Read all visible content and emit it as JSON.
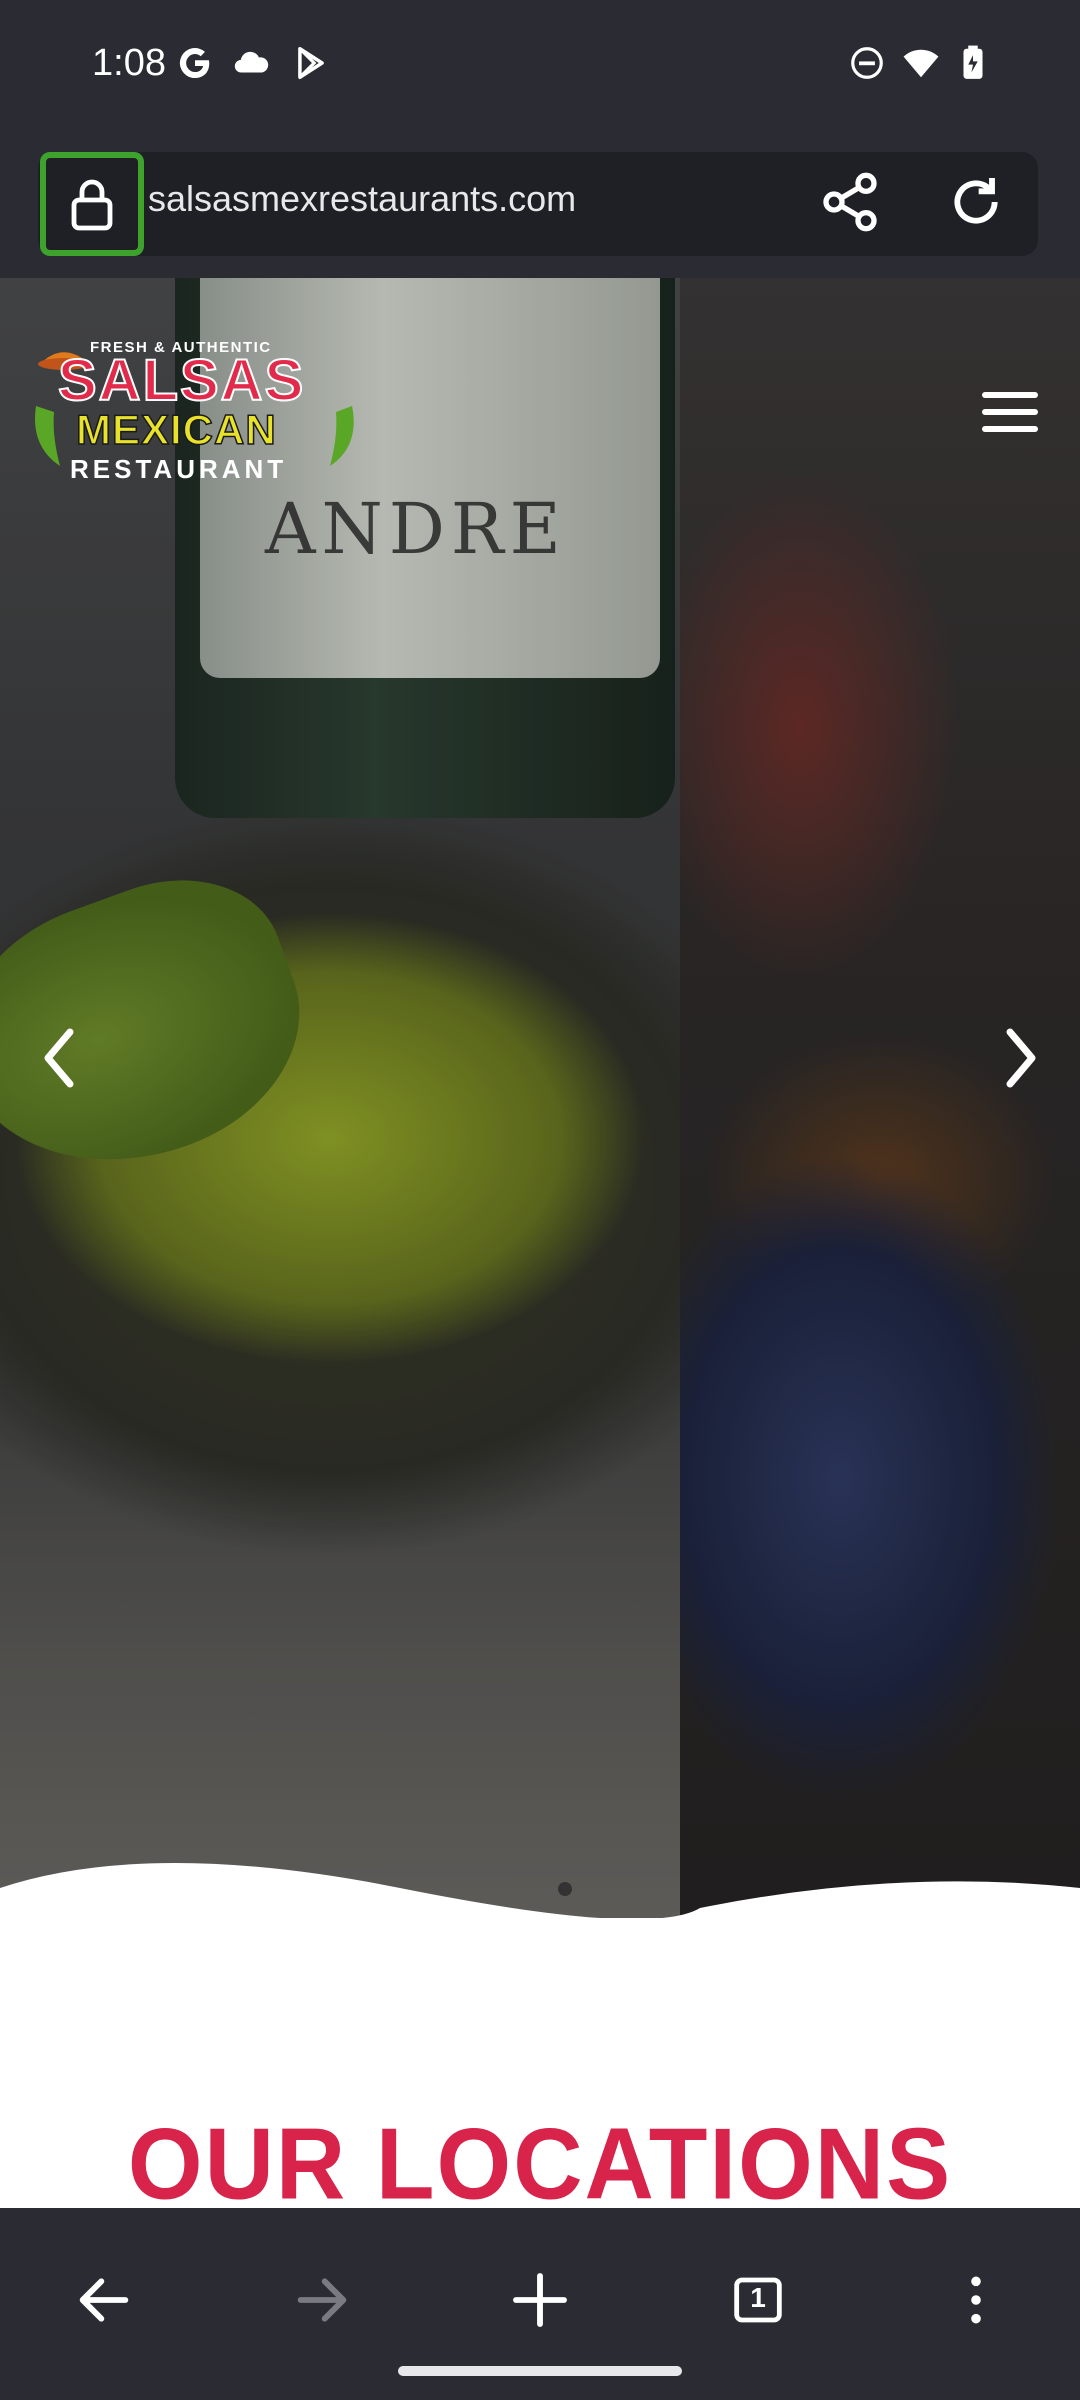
{
  "status_bar": {
    "time": "1:08",
    "left_icons": [
      "google-g-icon",
      "cloud-icon",
      "play-store-icon"
    ],
    "right_icons": [
      "do-not-disturb-icon",
      "wifi-icon",
      "battery-charging-icon"
    ]
  },
  "browser": {
    "url": "salsasmexrestaurants.com",
    "lock_icon": "lock-icon",
    "highlight_color": "#3ea32c"
  },
  "hero": {
    "logo": {
      "tagline": "FRESH & AUTHENTIC",
      "line1": "SALSAS",
      "line2": "MEXICAN",
      "line3": "RESTAURANT"
    },
    "bottle_text": "ANDRE",
    "prev_icon": "chevron-left-icon",
    "next_icon": "chevron-right-icon",
    "menu_icon": "hamburger-menu-icon"
  },
  "section": {
    "title": "OUR LOCATIONS",
    "title_color": "#d8234a"
  },
  "bottom_nav": {
    "tab_count": "1",
    "icons": [
      "back-arrow-icon",
      "forward-arrow-icon",
      "new-tab-icon",
      "tab-switcher-icon",
      "more-options-icon"
    ]
  }
}
